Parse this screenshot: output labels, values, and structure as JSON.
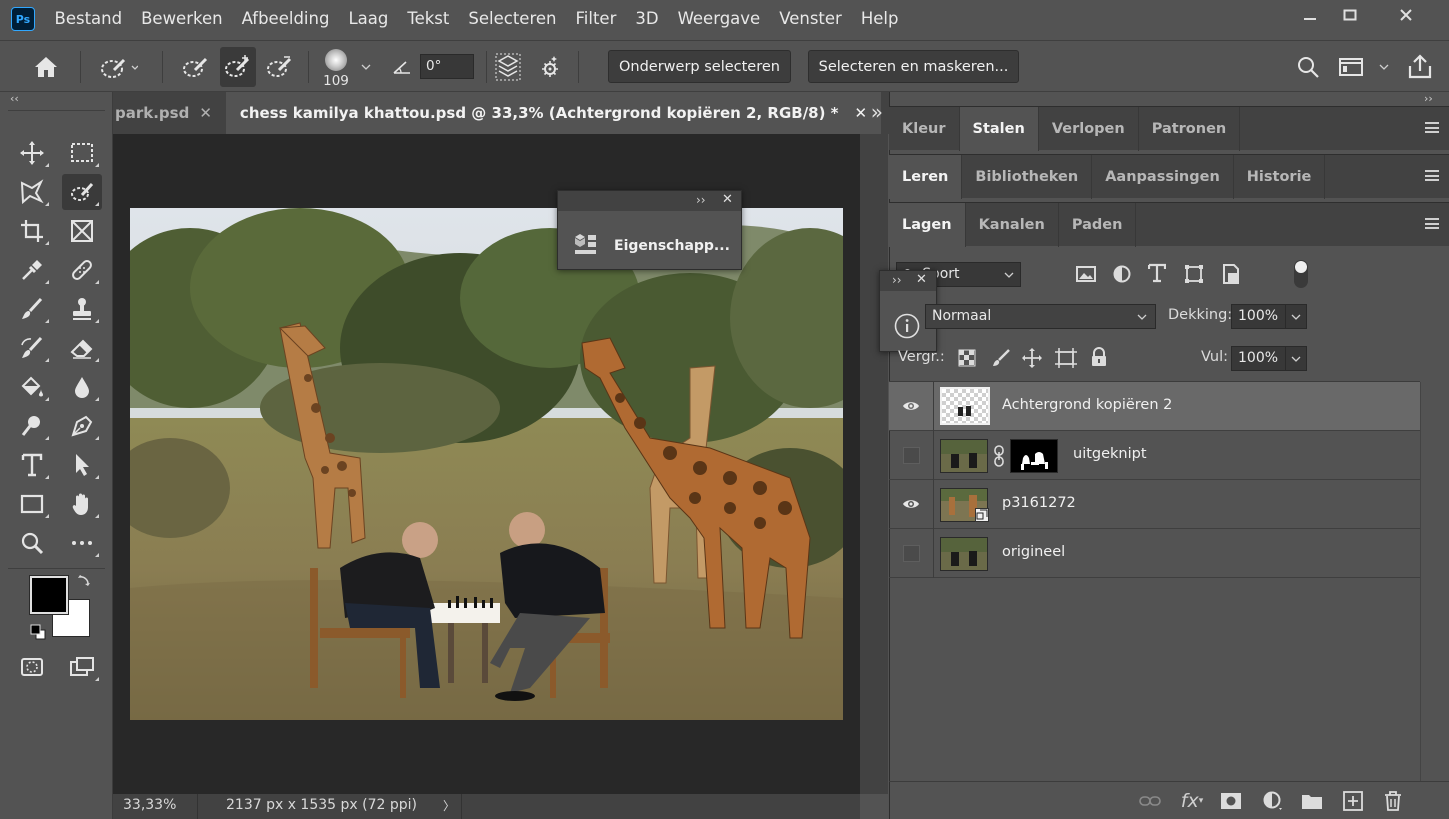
{
  "app": {
    "logo": "Ps",
    "menu": [
      "Bestand",
      "Bewerken",
      "Afbeelding",
      "Laag",
      "Tekst",
      "Selecteren",
      "Filter",
      "3D",
      "Weergave",
      "Venster",
      "Help"
    ]
  },
  "window_controls": [
    "minimize-icon",
    "maximize-icon",
    "close-icon"
  ],
  "options_bar": {
    "brush_size": "109",
    "angle": "0°",
    "select_subject_label": "Onderwerp selecteren",
    "select_and_mask_label": "Selecteren en maskeren..."
  },
  "documents": {
    "tabs": [
      {
        "title": "park.psd",
        "active": false
      },
      {
        "title": "chess kamilya khattou.psd @ 33,3% (Achtergrond kopiëren 2, RGB/8) *",
        "active": true
      }
    ],
    "overflow_label": "»"
  },
  "status_bar": {
    "zoom": "33,33%",
    "doc_info": "2137 px x 1535 px (72 ppi)",
    "arrow": "〉"
  },
  "properties_panel": {
    "label": "Eigenschapp..."
  },
  "panels": {
    "row1": [
      "Kleur",
      "Stalen",
      "Verlopen",
      "Patronen"
    ],
    "row1_active": "Stalen",
    "row2": [
      "Leren",
      "Bibliotheken",
      "Aanpassingen",
      "Historie"
    ],
    "row2_active": "Leren",
    "row3": [
      "Lagen",
      "Kanalen",
      "Paden"
    ],
    "row3_active": "Lagen"
  },
  "layers_panel": {
    "filter_kind": "Soort",
    "blend_mode": "Normaal",
    "opacity_label": "Dekking:",
    "opacity_value": "100%",
    "lock_label": "Vergr.:",
    "fill_label": "Vul:",
    "fill_value": "100%",
    "layers": [
      {
        "name": "Achtergrond kopiëren 2",
        "visible": true,
        "selected": true
      },
      {
        "name": "uitgeknipt",
        "visible": false,
        "selected": false,
        "has_mask": true
      },
      {
        "name": "p3161272",
        "visible": true,
        "selected": false,
        "smart_object": true
      },
      {
        "name": "origineel",
        "visible": false,
        "selected": false
      }
    ]
  },
  "colors": {
    "foreground": "#000000",
    "background": "#ffffff",
    "accent": "#31a8ff"
  }
}
